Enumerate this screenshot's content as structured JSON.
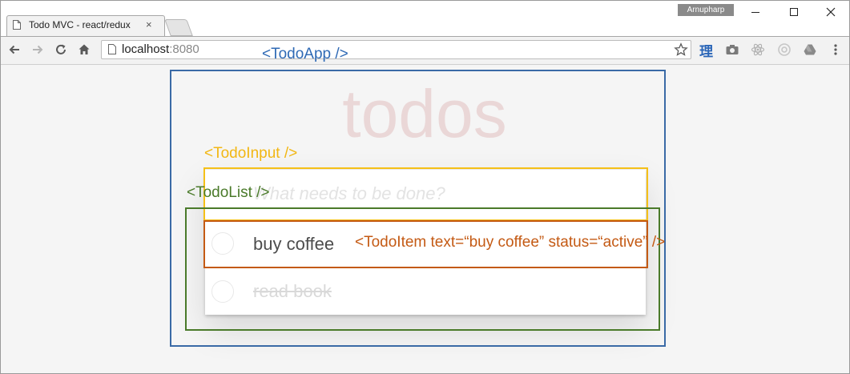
{
  "browser": {
    "tab_title": "Todo MVC - react/redux",
    "tab_close": "×",
    "user": "Arnupharp",
    "address_host": "localhost",
    "address_port": ":8080",
    "extension_glyph": "理"
  },
  "app": {
    "title": "todos",
    "input_placeholder": "What needs to be done?",
    "items": [
      {
        "text": "buy coffee",
        "status": "active"
      },
      {
        "text": "read book",
        "status": "completed"
      }
    ]
  },
  "annotations": {
    "todo_app": "<TodoApp />",
    "todo_input": "<TodoInput />",
    "todo_list": "<TodoList />",
    "todo_item": "<TodoItem text=“buy coffee” status=“active” />"
  },
  "colors": {
    "todo_app": "#3a6aa6",
    "todo_input": "#f5c018",
    "todo_list": "#4a7a2a",
    "todo_item": "#c45a14",
    "title": "#efd5d5",
    "accent_blue": "#2b66b8"
  }
}
